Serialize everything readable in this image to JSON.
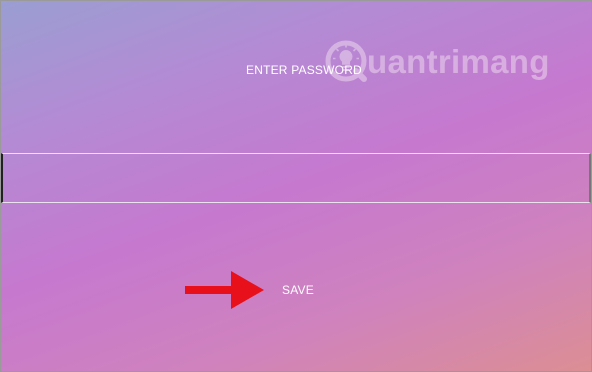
{
  "watermark": {
    "text": "uantrimang",
    "logo_icon": "lightbulb-q-logo"
  },
  "password_prompt": {
    "label": "ENTER PASSWORD",
    "value": "",
    "placeholder": ""
  },
  "save_label": "SAVE",
  "annotation": {
    "icon": "arrow-right-icon",
    "color": "#e8101a"
  },
  "colors": {
    "gradient_start": "#9a9ed2",
    "gradient_mid": "#c678cf",
    "gradient_end": "#dc8e94",
    "text": "#ffffff"
  }
}
